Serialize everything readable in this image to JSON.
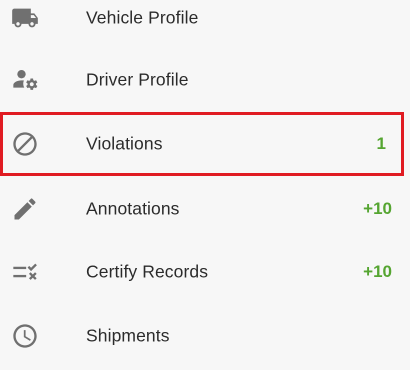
{
  "menu": {
    "items": [
      {
        "label": "Vehicle Profile",
        "icon": "truck-icon",
        "count": ""
      },
      {
        "label": "Driver Profile",
        "icon": "driver-settings-icon",
        "count": ""
      },
      {
        "label": "Violations",
        "icon": "block-icon",
        "count": "1",
        "highlighted": true
      },
      {
        "label": "Annotations",
        "icon": "pencil-icon",
        "count": "+10"
      },
      {
        "label": "Certify Records",
        "icon": "certify-icon",
        "count": "+10"
      },
      {
        "label": "Shipments",
        "icon": "clock-icon",
        "count": ""
      }
    ]
  },
  "colors": {
    "background": "#f7f7f7",
    "text": "#2b2b2b",
    "icon": "#707070",
    "count": "#55a531",
    "highlight_border": "#e01b22"
  }
}
